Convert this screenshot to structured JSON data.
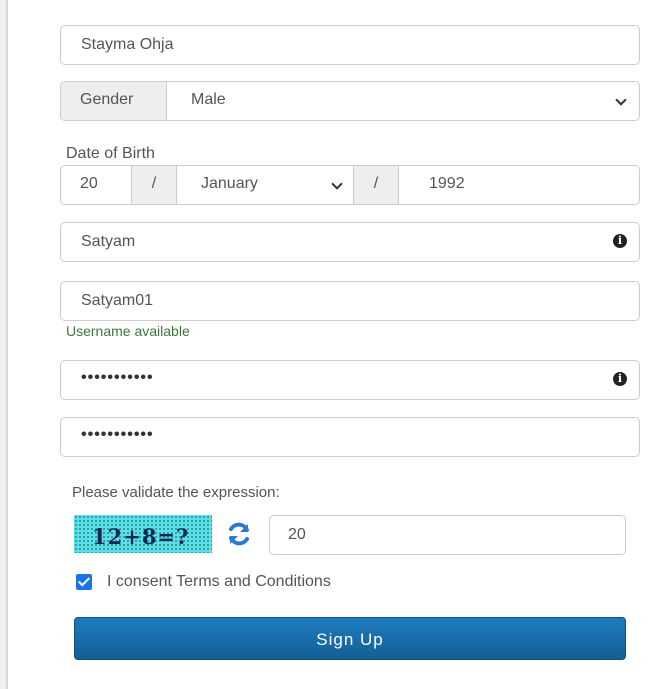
{
  "form": {
    "full_name": "Stayma Ohja",
    "gender": {
      "label": "Gender",
      "selected": "Male"
    },
    "dob": {
      "label": "Date of Birth",
      "day": "20",
      "separator": "/",
      "month": "January",
      "year": "1992"
    },
    "first_field": "Satyam",
    "username": "Satyam01",
    "username_status": "Username available",
    "password_mask": "•••••••••••",
    "confirm_mask": "•••••••••••",
    "captcha": {
      "prompt": "Please validate the expression:",
      "expression": "12+8=?",
      "answer": "20"
    },
    "consent": {
      "checked": true,
      "label": "I consent Terms and Conditions"
    },
    "submit_label": "Sign Up"
  },
  "colors": {
    "primary": "#1a6daa",
    "success": "#3c763d",
    "checkbox": "#1a73e8",
    "captcha_bg": "#5ce0e6"
  },
  "icons": [
    "info-icon",
    "refresh-icon",
    "chevron-down-icon",
    "check-icon"
  ]
}
